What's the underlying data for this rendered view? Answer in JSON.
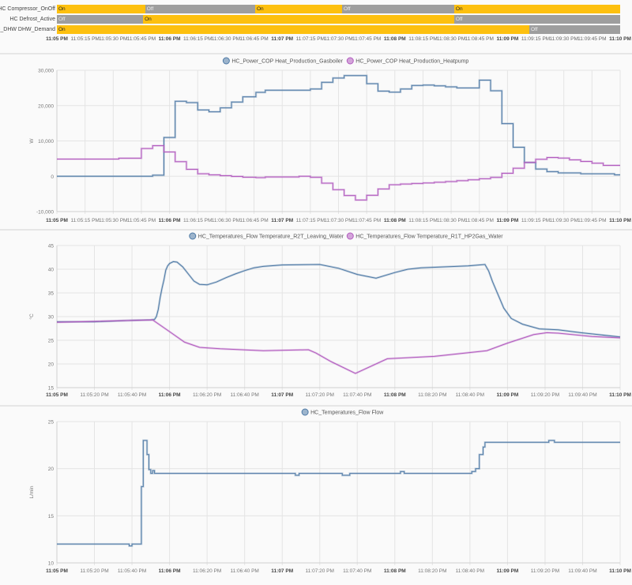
{
  "colors": {
    "on": "#fdc00f",
    "off": "#9e9e9e",
    "series_blue": "#4f7aa6",
    "series_purple": "#b25cbf",
    "grid": "#e4e4e4"
  },
  "timeline": {
    "rows": [
      {
        "label": "HC Compressor_OnOff",
        "segments": [
          {
            "state": "On",
            "start": 0,
            "end": 47
          },
          {
            "state": "Off",
            "start": 47,
            "end": 105.6
          },
          {
            "state": "On",
            "start": 105.6,
            "end": 151.9
          },
          {
            "state": "Off",
            "start": 151.9,
            "end": 211.6
          },
          {
            "state": "On",
            "start": 211.6,
            "end": 300
          }
        ]
      },
      {
        "label": "HC Defrost_Active",
        "segments": [
          {
            "state": "Off",
            "start": 0,
            "end": 45.9
          },
          {
            "state": "On",
            "start": 45.9,
            "end": 211.6
          },
          {
            "state": "Off",
            "start": 211.6,
            "end": 300
          }
        ]
      },
      {
        "label": "HC_DHW DHW_Demand",
        "segments": [
          {
            "state": "On",
            "start": 0,
            "end": 251.6
          },
          {
            "state": "Off",
            "start": 251.6,
            "end": 300
          }
        ]
      }
    ],
    "x_ticks": [
      "11:05 PM",
      "11:05:15 PM",
      "11:05:30 PM",
      "11:05:45 PM",
      "11:06 PM",
      "11:06:15 PM",
      "11:06:30 PM",
      "11:06:45 PM",
      "11:07 PM",
      "11:07:15 PM",
      "11:07:30 PM",
      "11:07:45 PM",
      "11:08 PM",
      "11:08:15 PM",
      "11:08:30 PM",
      "11:08:45 PM",
      "11:09 PM",
      "11:09:15 PM",
      "11:09:30 PM",
      "11:09:45 PM",
      "11:10 PM"
    ]
  },
  "chart_data": [
    {
      "type": "line",
      "step": true,
      "title": "",
      "xlabel": "",
      "ylabel": "W",
      "xlim": [
        0,
        300
      ],
      "ylim": [
        -10000,
        30000
      ],
      "y_ticks": [
        {
          "value": 30000,
          "label": "30,000"
        },
        {
          "value": 20000,
          "label": "20,000"
        },
        {
          "value": 10000,
          "label": "10,000"
        },
        {
          "value": 0,
          "label": "0"
        },
        {
          "value": -10000,
          "label": "-10,000"
        }
      ],
      "x_ticks": [
        "11:05 PM",
        "11:05:15 PM",
        "11:05:30 PM",
        "11:05:45 PM",
        "11:06 PM",
        "11:06:15 PM",
        "11:06:30 PM",
        "11:06:45 PM",
        "11:07 PM",
        "11:07:15 PM",
        "11:07:30 PM",
        "11:07:45 PM",
        "11:08 PM",
        "11:08:15 PM",
        "11:08:30 PM",
        "11:08:45 PM",
        "11:09 PM",
        "11:09:15 PM",
        "11:09:30 PM",
        "11:09:45 PM",
        "11:10 PM"
      ],
      "legend": "top-center",
      "grid": true,
      "series": [
        {
          "name": "HC_Power_COP Heat_Production_Gasboiler",
          "color": "#4f7aa6",
          "points": [
            [
              0,
              0
            ],
            [
              51,
              300
            ],
            [
              57,
              10970
            ],
            [
              63,
              21230
            ],
            [
              69,
              20850
            ],
            [
              75,
              18770
            ],
            [
              81,
              18240
            ],
            [
              87,
              19360
            ],
            [
              93,
              21000
            ],
            [
              99,
              22480
            ],
            [
              106,
              23750
            ],
            [
              111,
              24350
            ],
            [
              135,
              24700
            ],
            [
              141,
              26580
            ],
            [
              147,
              27800
            ],
            [
              153,
              28500
            ],
            [
              165,
              26200
            ],
            [
              171,
              24100
            ],
            [
              177,
              23800
            ],
            [
              183,
              24700
            ],
            [
              189,
              25700
            ],
            [
              195,
              25800
            ],
            [
              201,
              25600
            ],
            [
              207,
              25300
            ],
            [
              213,
              25000
            ],
            [
              225,
              27200
            ],
            [
              231,
              24200
            ],
            [
              237,
              14900
            ],
            [
              243,
              8200
            ],
            [
              249,
              3900
            ],
            [
              255,
              2050
            ],
            [
              261,
              1300
            ],
            [
              267,
              940
            ],
            [
              279,
              700
            ],
            [
              297,
              400
            ],
            [
              300,
              400
            ]
          ]
        },
        {
          "name": "HC_Power_COP Heat_Production_Heatpump",
          "color": "#b25cbf",
          "points": [
            [
              0,
              4860
            ],
            [
              33,
              5100
            ],
            [
              45,
              7850
            ],
            [
              51,
              8650
            ],
            [
              57,
              6870
            ],
            [
              63,
              4130
            ],
            [
              69,
              1960
            ],
            [
              75,
              710
            ],
            [
              81,
              400
            ],
            [
              87,
              170
            ],
            [
              93,
              -50
            ],
            [
              99,
              -280
            ],
            [
              106,
              -400
            ],
            [
              111,
              -200
            ],
            [
              129,
              0
            ],
            [
              135,
              -300
            ],
            [
              141,
              -1960
            ],
            [
              147,
              -3800
            ],
            [
              153,
              -5460
            ],
            [
              159,
              -6720
            ],
            [
              165,
              -5380
            ],
            [
              171,
              -3600
            ],
            [
              177,
              -2400
            ],
            [
              183,
              -2200
            ],
            [
              189,
              -2050
            ],
            [
              195,
              -1900
            ],
            [
              201,
              -1700
            ],
            [
              207,
              -1500
            ],
            [
              213,
              -1250
            ],
            [
              219,
              -1000
            ],
            [
              225,
              -700
            ],
            [
              231,
              -330
            ],
            [
              237,
              850
            ],
            [
              243,
              2270
            ],
            [
              249,
              3900
            ],
            [
              255,
              4800
            ],
            [
              261,
              5300
            ],
            [
              267,
              5150
            ],
            [
              273,
              4640
            ],
            [
              279,
              4200
            ],
            [
              285,
              3700
            ],
            [
              291,
              3080
            ],
            [
              300,
              3080
            ]
          ]
        }
      ]
    },
    {
      "type": "line",
      "step": false,
      "title": "",
      "xlabel": "",
      "ylabel": "°C",
      "xlim": [
        0,
        300
      ],
      "ylim": [
        15,
        45
      ],
      "y_ticks": [
        {
          "value": 45,
          "label": "45"
        },
        {
          "value": 40,
          "label": "40"
        },
        {
          "value": 35,
          "label": "35"
        },
        {
          "value": 30,
          "label": "30"
        },
        {
          "value": 25,
          "label": "25"
        },
        {
          "value": 20,
          "label": "20"
        },
        {
          "value": 15,
          "label": "15"
        }
      ],
      "x_ticks": [
        "11:05 PM",
        "11:05:20 PM",
        "11:05:40 PM",
        "11:06 PM",
        "11:06:20 PM",
        "11:06:40 PM",
        "11:07 PM",
        "11:07:20 PM",
        "11:07:40 PM",
        "11:08 PM",
        "11:08:20 PM",
        "11:08:40 PM",
        "11:09 PM",
        "11:09:20 PM",
        "11:09:40 PM",
        "11:10 PM"
      ],
      "legend": "top-center",
      "grid": true,
      "series": [
        {
          "name": "HC_Temperatures_Flow Temperature_R2T_Leaving_Water",
          "color": "#4f7aa6",
          "points": [
            [
              0,
              28.9
            ],
            [
              20,
              28.9
            ],
            [
              40,
              29.2
            ],
            [
              50,
              29.3
            ],
            [
              52,
              29.4
            ],
            [
              53,
              30
            ],
            [
              54,
              31.5
            ],
            [
              55,
              34
            ],
            [
              56,
              36
            ],
            [
              57,
              37.7
            ],
            [
              58,
              39.8
            ],
            [
              59,
              40.7
            ],
            [
              60,
              41.2
            ],
            [
              62,
              41.6
            ],
            [
              64,
              41.5
            ],
            [
              67,
              40.5
            ],
            [
              70,
              39
            ],
            [
              73,
              37.5
            ],
            [
              76,
              36.8
            ],
            [
              80,
              36.7
            ],
            [
              85,
              37.3
            ],
            [
              90,
              38.2
            ],
            [
              95,
              39
            ],
            [
              100,
              39.7
            ],
            [
              105,
              40.3
            ],
            [
              110,
              40.6
            ],
            [
              120,
              40.9
            ],
            [
              140,
              41
            ],
            [
              150,
              40.2
            ],
            [
              160,
              38.9
            ],
            [
              170,
              38.1
            ],
            [
              180,
              39.3
            ],
            [
              187,
              40
            ],
            [
              194,
              40.3
            ],
            [
              219,
              40.7
            ],
            [
              228,
              41
            ],
            [
              230,
              39.6
            ],
            [
              232,
              37.4
            ],
            [
              235,
              34.6
            ],
            [
              238,
              31.8
            ],
            [
              242,
              29.6
            ],
            [
              248,
              28.4
            ],
            [
              257,
              27.4
            ],
            [
              267,
              27.2
            ],
            [
              279,
              26.6
            ],
            [
              300,
              25.7
            ]
          ]
        },
        {
          "name": "HC_Temperatures_Flow Temperature_R1T_HP2Gas_Water",
          "color": "#b25cbf",
          "points": [
            [
              0,
              28.8
            ],
            [
              51,
              29.3
            ],
            [
              59,
              27.1
            ],
            [
              68,
              24.6
            ],
            [
              76,
              23.5
            ],
            [
              87,
              23.2
            ],
            [
              110,
              22.8
            ],
            [
              134,
              23
            ],
            [
              138,
              22.3
            ],
            [
              146,
              20.5
            ],
            [
              159,
              18
            ],
            [
              176,
              21.1
            ],
            [
              201,
              21.6
            ],
            [
              229,
              22.8
            ],
            [
              240,
              24.4
            ],
            [
              254,
              26.2
            ],
            [
              261,
              26.6
            ],
            [
              267,
              26.5
            ],
            [
              285,
              25.8
            ],
            [
              300,
              25.5
            ]
          ]
        }
      ]
    },
    {
      "type": "line",
      "step": true,
      "title": "",
      "xlabel": "",
      "ylabel": "L/min",
      "xlim": [
        0,
        300
      ],
      "ylim": [
        10,
        25
      ],
      "y_ticks": [
        {
          "value": 25,
          "label": "25"
        },
        {
          "value": 20,
          "label": "20"
        },
        {
          "value": 15,
          "label": "15"
        },
        {
          "value": 10,
          "label": "10"
        }
      ],
      "x_ticks": [
        "11:05 PM",
        "11:05:20 PM",
        "11:05:40 PM",
        "11:06 PM",
        "11:06:20 PM",
        "11:06:40 PM",
        "11:07 PM",
        "11:07:20 PM",
        "11:07:40 PM",
        "11:08 PM",
        "11:08:20 PM",
        "11:08:40 PM",
        "11:09 PM",
        "11:09:20 PM",
        "11:09:40 PM",
        "11:10 PM"
      ],
      "legend": "top-center",
      "grid": true,
      "series": [
        {
          "name": "HC_Temperatures_Flow Flow",
          "color": "#4f7aa6",
          "points": [
            [
              0,
              12
            ],
            [
              38.5,
              11.8
            ],
            [
              40,
              12
            ],
            [
              45,
              18.1
            ],
            [
              46,
              23
            ],
            [
              48,
              21.5
            ],
            [
              49,
              19.9
            ],
            [
              50,
              19.5
            ],
            [
              51,
              19.8
            ],
            [
              52,
              19.5
            ],
            [
              127,
              19.3
            ],
            [
              129,
              19.5
            ],
            [
              152,
              19.3
            ],
            [
              156,
              19.5
            ],
            [
              183,
              19.7
            ],
            [
              185,
              19.5
            ],
            [
              221,
              19.7
            ],
            [
              223,
              20
            ],
            [
              225,
              21.5
            ],
            [
              227,
              22.3
            ],
            [
              228,
              22.8
            ],
            [
              262,
              23
            ],
            [
              265,
              22.8
            ],
            [
              300,
              22.8
            ]
          ]
        }
      ]
    }
  ]
}
